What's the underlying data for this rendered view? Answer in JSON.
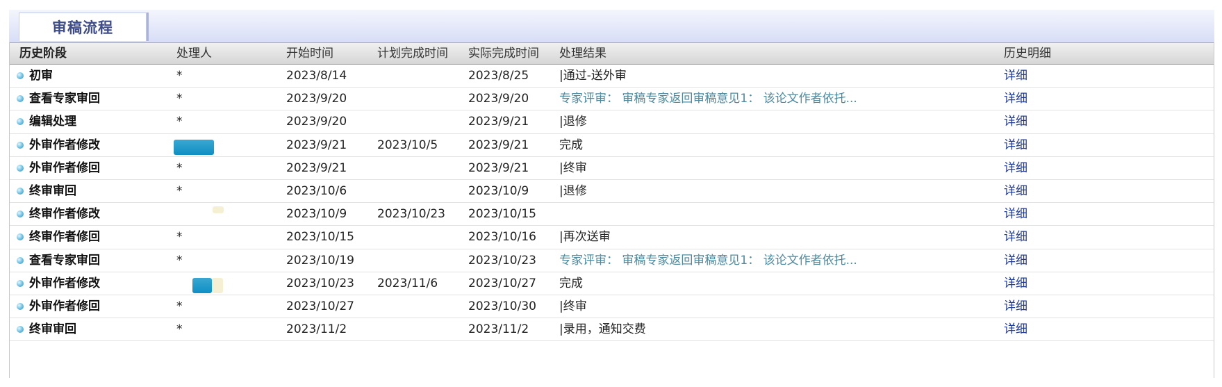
{
  "tab": {
    "label": "审稿流程"
  },
  "headers": {
    "stage": "历史阶段",
    "handler": "处理人",
    "start": "开始时间",
    "plan": "计划完成时间",
    "actual": "实际完成时间",
    "result": "处理结果",
    "detail": "历史明细"
  },
  "rows": [
    {
      "stage": "初审",
      "handler": "*",
      "start": "2023/8/14",
      "plan": "",
      "actual": "2023/8/25",
      "result": "|通过-送外审",
      "detail": "详细"
    },
    {
      "stage": "查看专家审回",
      "handler": "*",
      "start": "2023/9/20",
      "plan": "",
      "actual": "2023/9/20",
      "result": "专家评审：  审稿专家返回审稿意见1：  该论文作者依托...",
      "detail": "详细"
    },
    {
      "stage": "编辑处理",
      "handler": "*",
      "start": "2023/9/20",
      "plan": "",
      "actual": "2023/9/21",
      "result": "|退修",
      "detail": "详细"
    },
    {
      "stage": "外审作者修改",
      "handler": "",
      "start": "2023/9/21",
      "plan": "2023/10/5",
      "actual": "2023/9/21",
      "result": "完成",
      "detail": "详细"
    },
    {
      "stage": "外审作者修回",
      "handler": "*",
      "start": "2023/9/21",
      "plan": "",
      "actual": "2023/9/21",
      "result": "|终审",
      "detail": "详细"
    },
    {
      "stage": "终审审回",
      "handler": "*",
      "start": "2023/10/6",
      "plan": "",
      "actual": "2023/10/9",
      "result": "|退修",
      "detail": "详细"
    },
    {
      "stage": "终审作者修改",
      "handler": "",
      "start": "2023/10/9",
      "plan": "2023/10/23",
      "actual": "2023/10/15",
      "result": "",
      "detail": "详细"
    },
    {
      "stage": "终审作者修回",
      "handler": "*",
      "start": "2023/10/15",
      "plan": "",
      "actual": "2023/10/16",
      "result": "|再次送审",
      "detail": "详细"
    },
    {
      "stage": "查看专家审回",
      "handler": "*",
      "start": "2023/10/19",
      "plan": "",
      "actual": "2023/10/23",
      "result": "专家评审：  审稿专家返回审稿意见1：  该论文作者依托...",
      "detail": "详细"
    },
    {
      "stage": "外审作者修改",
      "handler": "",
      "start": "2023/10/23",
      "plan": "2023/11/6",
      "actual": "2023/10/27",
      "result": "完成",
      "detail": "详细"
    },
    {
      "stage": "外审作者修回",
      "handler": "*",
      "start": "2023/10/27",
      "plan": "",
      "actual": "2023/10/30",
      "result": "|终审",
      "detail": "详细"
    },
    {
      "stage": "终审审回",
      "handler": "*",
      "start": "2023/11/2",
      "plan": "",
      "actual": "2023/11/2",
      "result": "|录用，通知交费",
      "detail": "详细"
    }
  ]
}
